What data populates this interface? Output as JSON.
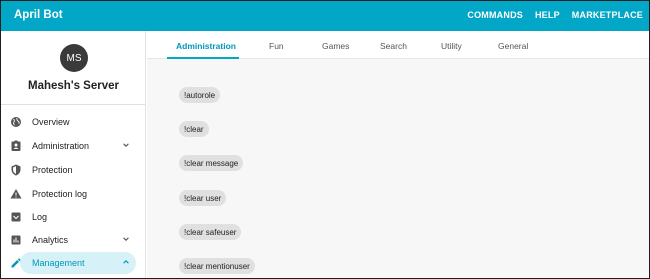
{
  "appbar": {
    "title": "April Bot",
    "nav": [
      "COMMANDS",
      "HELP",
      "MARKETPLACE"
    ],
    "bg_color": "#02a6c6"
  },
  "sidebar": {
    "avatar_initials": "MS",
    "server_name": "Mahesh's Server",
    "items": [
      {
        "label": "Overview",
        "icon": "globe-icon"
      },
      {
        "label": "Administration",
        "icon": "badge-icon",
        "chevron": "down"
      },
      {
        "label": "Protection",
        "icon": "shield-icon"
      },
      {
        "label": "Protection log",
        "icon": "warning-icon"
      },
      {
        "label": "Log",
        "icon": "inbox-icon"
      },
      {
        "label": "Analytics",
        "icon": "bar-chart-icon",
        "chevron": "down"
      },
      {
        "label": "Management",
        "icon": "pencil-icon",
        "chevron": "up",
        "active": true
      }
    ]
  },
  "tabs": [
    "Administration",
    "Fun",
    "Games",
    "Search",
    "Utility",
    "General"
  ],
  "active_tab": "Administration",
  "commands": [
    "!autorole",
    "!clear",
    "!clear message",
    "!clear user",
    "!clear safeuser",
    "!clear mentionuser"
  ]
}
